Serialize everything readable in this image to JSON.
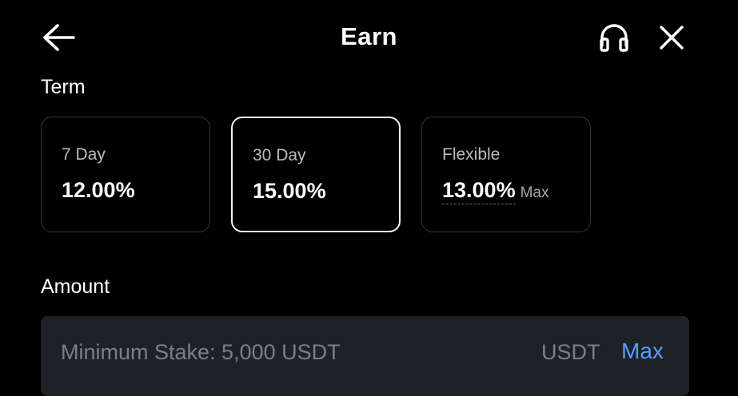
{
  "header": {
    "title": "Earn",
    "back_icon": "arrow-left-icon",
    "support_icon": "headset-icon",
    "close_icon": "close-icon"
  },
  "term": {
    "label": "Term",
    "options": [
      {
        "name": "7 Day",
        "rate": "12.00%",
        "suffix": "",
        "selected": false
      },
      {
        "name": "30 Day",
        "rate": "15.00%",
        "suffix": "",
        "selected": true
      },
      {
        "name": "Flexible",
        "rate": "13.00%",
        "suffix": "Max",
        "selected": false
      }
    ]
  },
  "amount": {
    "label": "Amount",
    "placeholder": "Minimum Stake: 5,000 USDT",
    "unit": "USDT",
    "max_label": "Max"
  },
  "colors": {
    "background": "#000000",
    "card_border": "#33363d",
    "selected_border": "#f2f2f2",
    "input_bg": "#1e2128",
    "accent": "#5b9cff",
    "muted_text": "#7b7f87"
  }
}
